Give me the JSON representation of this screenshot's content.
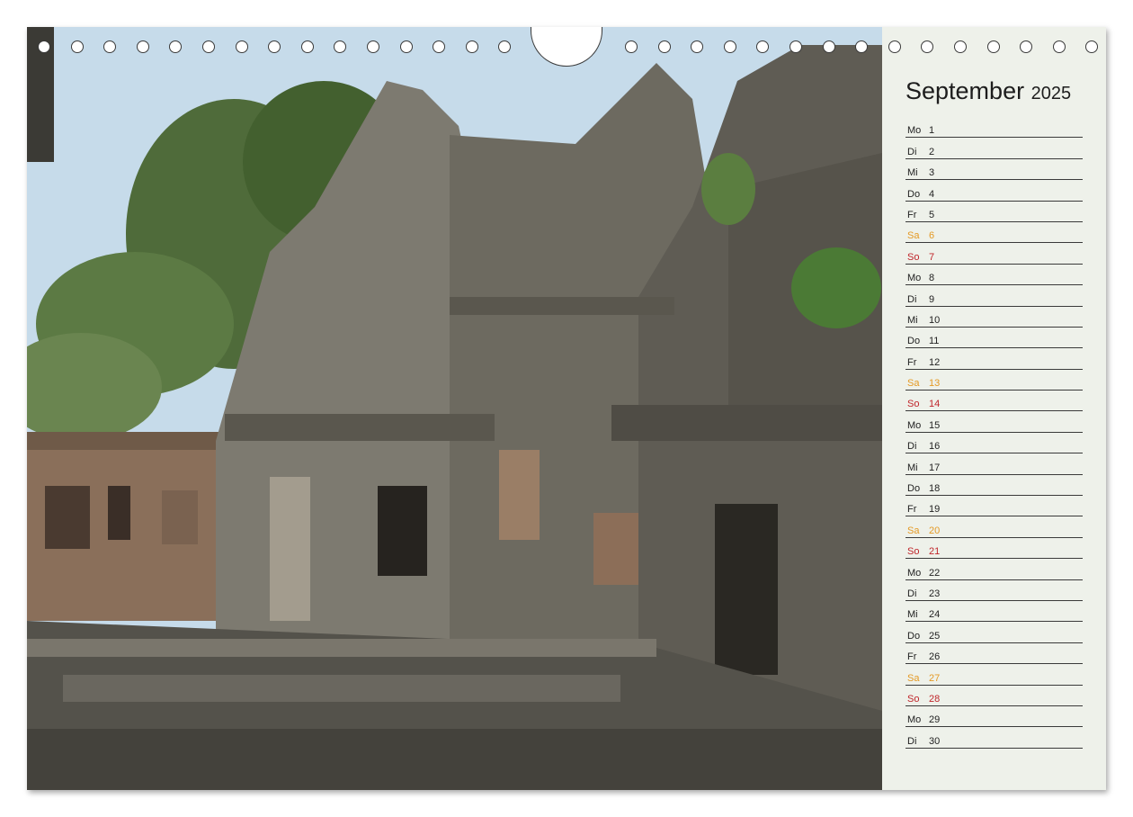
{
  "calendar": {
    "month": "September",
    "year": "2025",
    "days": [
      {
        "dow": "Mo",
        "day": "1",
        "type": "weekday"
      },
      {
        "dow": "Di",
        "day": "2",
        "type": "weekday"
      },
      {
        "dow": "Mi",
        "day": "3",
        "type": "weekday"
      },
      {
        "dow": "Do",
        "day": "4",
        "type": "weekday"
      },
      {
        "dow": "Fr",
        "day": "5",
        "type": "weekday"
      },
      {
        "dow": "Sa",
        "day": "6",
        "type": "sat"
      },
      {
        "dow": "So",
        "day": "7",
        "type": "sun"
      },
      {
        "dow": "Mo",
        "day": "8",
        "type": "weekday"
      },
      {
        "dow": "Di",
        "day": "9",
        "type": "weekday"
      },
      {
        "dow": "Mi",
        "day": "10",
        "type": "weekday"
      },
      {
        "dow": "Do",
        "day": "11",
        "type": "weekday"
      },
      {
        "dow": "Fr",
        "day": "12",
        "type": "weekday"
      },
      {
        "dow": "Sa",
        "day": "13",
        "type": "sat"
      },
      {
        "dow": "So",
        "day": "14",
        "type": "sun"
      },
      {
        "dow": "Mo",
        "day": "15",
        "type": "weekday"
      },
      {
        "dow": "Di",
        "day": "16",
        "type": "weekday"
      },
      {
        "dow": "Mi",
        "day": "17",
        "type": "weekday"
      },
      {
        "dow": "Do",
        "day": "18",
        "type": "weekday"
      },
      {
        "dow": "Fr",
        "day": "19",
        "type": "weekday"
      },
      {
        "dow": "Sa",
        "day": "20",
        "type": "sat"
      },
      {
        "dow": "So",
        "day": "21",
        "type": "sun"
      },
      {
        "dow": "Mo",
        "day": "22",
        "type": "weekday"
      },
      {
        "dow": "Di",
        "day": "23",
        "type": "weekday"
      },
      {
        "dow": "Mi",
        "day": "24",
        "type": "weekday"
      },
      {
        "dow": "Do",
        "day": "25",
        "type": "weekday"
      },
      {
        "dow": "Fr",
        "day": "26",
        "type": "weekday"
      },
      {
        "dow": "Sa",
        "day": "27",
        "type": "sat"
      },
      {
        "dow": "So",
        "day": "28",
        "type": "sun"
      },
      {
        "dow": "Mo",
        "day": "29",
        "type": "weekday"
      },
      {
        "dow": "Di",
        "day": "30",
        "type": "weekday"
      }
    ]
  },
  "colors": {
    "saturday": "#e49a25",
    "sunday": "#c0262b",
    "weekday": "#222222",
    "panel": "#eef1ea"
  },
  "photo": {
    "subject-icon": "temple-ruins-photo"
  }
}
